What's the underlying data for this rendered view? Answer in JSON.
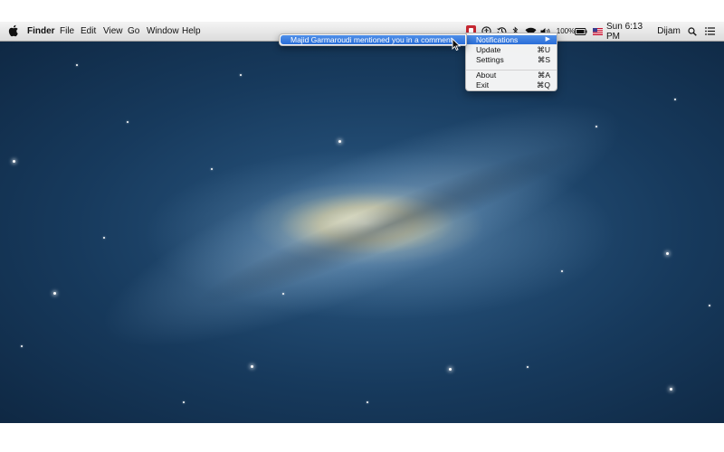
{
  "menubar": {
    "app_name": "Finder",
    "menus": [
      "File",
      "Edit",
      "View",
      "Go",
      "Window",
      "Help"
    ],
    "battery_percent": "100%",
    "datetime": "Sun 6:13 PM",
    "user": "Dijam"
  },
  "dropdown": {
    "items": [
      {
        "label": "Notifications",
        "shortcut": "▶"
      },
      {
        "label": "Update",
        "shortcut": "⌘U"
      },
      {
        "label": "Settings",
        "shortcut": "⌘S"
      },
      {
        "label": "About",
        "shortcut": "⌘A"
      },
      {
        "label": "Exit",
        "shortcut": "⌘Q"
      }
    ]
  },
  "submenu": {
    "items": [
      {
        "label": "Majid Garmaroudi mentioned you in a comment"
      }
    ]
  },
  "icons": [
    "apple-icon",
    "app-status-icon",
    "accessibility-icon",
    "time-machine-icon",
    "bluetooth-icon",
    "wifi-icon",
    "volume-icon",
    "battery-icon",
    "flag-icon",
    "spotlight-icon",
    "notification-center-icon"
  ],
  "colors": {
    "highlight": "#2f74dd",
    "app_icon": "#c62832"
  }
}
